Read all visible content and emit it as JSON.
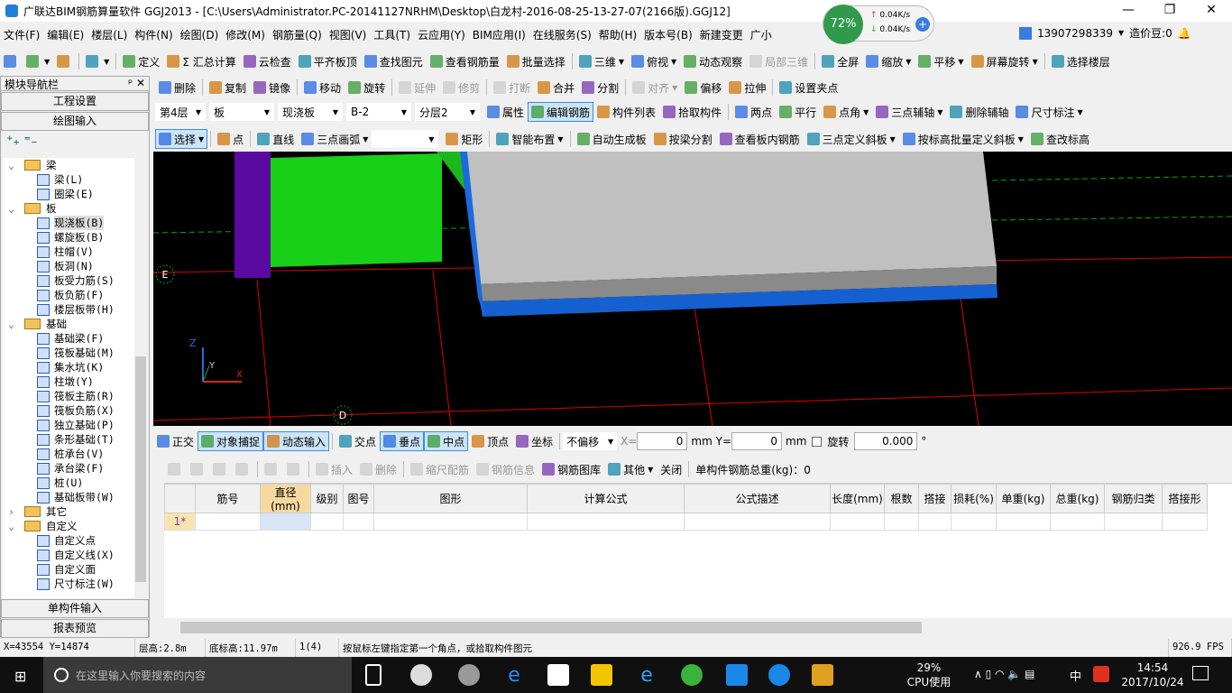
{
  "title": "广联达BIM钢筋算量软件 GGJ2013 - [C:\\Users\\Administrator.PC-20141127NRHM\\Desktop\\白龙村-2016-08-25-13-27-07(2166版).GGJ12]",
  "net_widget": {
    "percent": "72%",
    "up": "0.04K/s",
    "down": "0.04K/s"
  },
  "menu": [
    "文件(F)",
    "编辑(E)",
    "楼层(L)",
    "构件(N)",
    "绘图(D)",
    "修改(M)",
    "钢筋量(Q)",
    "视图(V)",
    "工具(T)",
    "云应用(Y)",
    "BIM应用(I)",
    "在线服务(S)",
    "帮助(H)",
    "版本号(B)",
    "新建变更",
    "广小"
  ],
  "account": {
    "phone": "13907298339",
    "beans": "造价豆:0"
  },
  "toolbar1": [
    {
      "icon": "new-file"
    },
    {
      "icon": "open-folder",
      "dd": true
    },
    {
      "icon": "save"
    },
    {
      "sep": true
    },
    {
      "icon": "undo",
      "dd": true
    },
    {
      "sep": true
    },
    {
      "label": "定义",
      "icon": "define"
    },
    {
      "label": "Σ 汇总计算",
      "icon": "sum"
    },
    {
      "label": "云检查",
      "icon": "cloud-check"
    },
    {
      "label": "平齐板顶",
      "icon": "align-slab"
    },
    {
      "label": "查找图元",
      "icon": "find"
    },
    {
      "label": "查看钢筋量",
      "icon": "view-rebar"
    },
    {
      "label": "批量选择",
      "icon": "batch-select"
    },
    {
      "sep": true
    },
    {
      "label": "三维",
      "icon": "3d",
      "dd": true
    },
    {
      "label": "俯视",
      "icon": "top-view",
      "dd": true
    },
    {
      "label": "动态观察",
      "icon": "orbit"
    },
    {
      "label": "局部三维",
      "icon": "local-3d",
      "disabled": true
    },
    {
      "sep": true
    },
    {
      "label": "全屏",
      "icon": "fullscreen"
    },
    {
      "label": "缩放",
      "icon": "zoom",
      "dd": true
    },
    {
      "label": "平移",
      "icon": "pan",
      "dd": true
    },
    {
      "label": "屏幕旋转",
      "icon": "rotate-screen",
      "dd": true
    },
    {
      "sep": true
    },
    {
      "label": "选择楼层",
      "icon": "select-floor"
    }
  ],
  "toolbar2": [
    {
      "label": "删除",
      "icon": "delete"
    },
    {
      "sep": true
    },
    {
      "label": "复制",
      "icon": "copy"
    },
    {
      "label": "镜像",
      "icon": "mirror"
    },
    {
      "sep": true
    },
    {
      "label": "移动",
      "icon": "move"
    },
    {
      "label": "旋转",
      "icon": "rotate"
    },
    {
      "sep": true
    },
    {
      "label": "延伸",
      "icon": "extend",
      "disabled": true
    },
    {
      "label": "修剪",
      "icon": "trim",
      "disabled": true
    },
    {
      "sep": true
    },
    {
      "label": "打断",
      "icon": "break",
      "disabled": true
    },
    {
      "label": "合并",
      "icon": "merge"
    },
    {
      "label": "分割",
      "icon": "split"
    },
    {
      "sep": true
    },
    {
      "label": "对齐",
      "icon": "align",
      "dd": true,
      "disabled": true
    },
    {
      "label": "偏移",
      "icon": "offset"
    },
    {
      "label": "拉伸",
      "icon": "stretch"
    },
    {
      "sep": true
    },
    {
      "label": "设置夹点",
      "icon": "grip"
    }
  ],
  "selectors": [
    "第4层",
    "板",
    "现浇板",
    "B-2",
    "分层2"
  ],
  "toolbar3": [
    {
      "label": "属性",
      "icon": "properties"
    },
    {
      "label": "编辑钢筋",
      "icon": "edit-rebar",
      "active": true
    },
    {
      "label": "构件列表",
      "icon": "component-list"
    },
    {
      "label": "拾取构件",
      "icon": "pick"
    },
    {
      "sep": true
    },
    {
      "label": "两点",
      "icon": "two-point"
    },
    {
      "label": "平行",
      "icon": "parallel"
    },
    {
      "label": "点角",
      "icon": "point-angle",
      "dd": true
    },
    {
      "label": "三点辅轴",
      "icon": "three-point-axis",
      "dd": true
    },
    {
      "label": "删除辅轴",
      "icon": "delete-axis"
    },
    {
      "label": "尺寸标注",
      "icon": "dimension",
      "dd": true
    }
  ],
  "toolbar4": [
    {
      "label": "选择",
      "icon": "select",
      "active": true,
      "dd": true
    },
    {
      "sep": true
    },
    {
      "label": "点",
      "icon": "point"
    },
    {
      "sep": true
    },
    {
      "label": "直线",
      "icon": "line"
    },
    {
      "label": "三点画弧",
      "icon": "arc",
      "dd": true
    },
    {
      "combo": ""
    },
    {
      "label": "矩形",
      "icon": "rectangle"
    },
    {
      "sep": true
    },
    {
      "label": "智能布置",
      "icon": "smart-layout",
      "dd": true
    },
    {
      "sep": true
    },
    {
      "label": "自动生成板",
      "icon": "auto-slab"
    },
    {
      "label": "按梁分割",
      "icon": "split-by-beam"
    },
    {
      "label": "查看板内钢筋",
      "icon": "view-slab-rebar"
    },
    {
      "label": "三点定义斜板",
      "icon": "sloped-slab",
      "dd": true
    },
    {
      "label": "按标高批量定义斜板",
      "icon": "batch-sloped",
      "dd": true
    },
    {
      "label": "查改标高",
      "icon": "elevation"
    }
  ],
  "panel": {
    "title": "模块导航栏",
    "project_settings": "工程设置",
    "drawing_input": "绘图输入",
    "single_input": "单构件输入",
    "report_preview": "报表预览"
  },
  "tree": [
    {
      "label": "梁",
      "folder": true,
      "lvl": 0
    },
    {
      "label": "梁(L)",
      "lvl": 1
    },
    {
      "label": "圈梁(E)",
      "lvl": 1
    },
    {
      "label": "板",
      "folder": true,
      "lvl": 0
    },
    {
      "label": "现浇板(B)",
      "lvl": 1,
      "selected": true
    },
    {
      "label": "螺旋板(B)",
      "lvl": 1
    },
    {
      "label": "柱帽(V)",
      "lvl": 1
    },
    {
      "label": "板洞(N)",
      "lvl": 1
    },
    {
      "label": "板受力筋(S)",
      "lvl": 1
    },
    {
      "label": "板负筋(F)",
      "lvl": 1
    },
    {
      "label": "楼层板带(H)",
      "lvl": 1
    },
    {
      "label": "基础",
      "folder": true,
      "lvl": 0
    },
    {
      "label": "基础梁(F)",
      "lvl": 1
    },
    {
      "label": "筏板基础(M)",
      "lvl": 1
    },
    {
      "label": "集水坑(K)",
      "lvl": 1
    },
    {
      "label": "柱墩(Y)",
      "lvl": 1
    },
    {
      "label": "筏板主筋(R)",
      "lvl": 1
    },
    {
      "label": "筏板负筋(X)",
      "lvl": 1
    },
    {
      "label": "独立基础(P)",
      "lvl": 1
    },
    {
      "label": "条形基础(T)",
      "lvl": 1
    },
    {
      "label": "桩承台(V)",
      "lvl": 1
    },
    {
      "label": "承台梁(F)",
      "lvl": 1
    },
    {
      "label": "桩(U)",
      "lvl": 1
    },
    {
      "label": "基础板带(W)",
      "lvl": 1
    },
    {
      "label": "其它",
      "folder": true,
      "lvl": 0,
      "collapsed": true
    },
    {
      "label": "自定义",
      "folder": true,
      "lvl": 0
    },
    {
      "label": "自定义点",
      "lvl": 1
    },
    {
      "label": "自定义线(X)",
      "lvl": 1
    },
    {
      "label": "自定义面",
      "lvl": 1
    },
    {
      "label": "尺寸标注(W)",
      "lvl": 1
    }
  ],
  "viewport": {
    "axis_labels": [
      "E",
      "D"
    ],
    "axes": {
      "z": "Z",
      "y": "Y",
      "x": "X"
    }
  },
  "snapbar": {
    "items": [
      {
        "label": "正交",
        "icon": "ortho"
      },
      {
        "label": "对象捕捉",
        "icon": "object-snap",
        "active": true
      },
      {
        "label": "动态输入",
        "icon": "dynamic-input",
        "active": true
      },
      {
        "sep": true
      },
      {
        "label": "交点",
        "icon": "intersection"
      },
      {
        "label": "垂点",
        "icon": "perpendicular",
        "active": true
      },
      {
        "label": "中点",
        "icon": "midpoint",
        "active": true
      },
      {
        "label": "顶点",
        "icon": "vertex"
      },
      {
        "label": "坐标",
        "icon": "coordinate"
      },
      {
        "sep": true
      }
    ],
    "offset": "不偏移",
    "x_label": "X=",
    "x_value": "0",
    "y_label": "Y=",
    "y_value": "0",
    "unit": "mm",
    "rotate_label": "旋转",
    "rotate_value": "0.000",
    "degree": "°"
  },
  "grid_toolbar": [
    {
      "icon": "first",
      "disabled": true
    },
    {
      "icon": "prev",
      "disabled": true
    },
    {
      "icon": "next",
      "disabled": true
    },
    {
      "icon": "last",
      "disabled": true
    },
    {
      "sep": true
    },
    {
      "icon": "up",
      "disabled": true
    },
    {
      "icon": "down",
      "disabled": true
    },
    {
      "sep": true
    },
    {
      "label": "插入",
      "icon": "insert",
      "disabled": true
    },
    {
      "label": "删除",
      "icon": "delete",
      "disabled": true
    },
    {
      "sep": true
    },
    {
      "label": "缩尺配筋",
      "icon": "scale-rebar",
      "disabled": true
    },
    {
      "label": "钢筋信息",
      "icon": "rebar-info",
      "disabled": true
    },
    {
      "label": "钢筋图库",
      "icon": "rebar-library"
    },
    {
      "label": "其他",
      "icon": "other",
      "dd": true
    },
    {
      "label": "关闭"
    },
    {
      "sep": true
    },
    {
      "label": "单构件钢筋总重(kg)：0"
    }
  ],
  "table": {
    "headers": [
      "",
      "筋号",
      "直径(mm)",
      "级别",
      "图号",
      "图形",
      "计算公式",
      "公式描述",
      "长度(mm)",
      "根数",
      "搭接",
      "损耗(%)",
      "单重(kg)",
      "总重(kg)",
      "钢筋归类",
      "搭接形"
    ],
    "rows": [
      [
        "1*",
        "",
        "",
        "",
        "",
        "",
        "",
        "",
        "",
        "",
        "",
        "",
        "",
        "",
        "",
        ""
      ]
    ]
  },
  "status": [
    "X=43554 Y=14874",
    "层高:2.8m",
    "底标高:11.97m",
    "1(4)",
    "按鼠标左键指定第一个角点，或拾取构件图元",
    "926.9 FPS"
  ],
  "taskbar": {
    "search_placeholder": "在这里输入你要搜索的内容",
    "cpu": "29%",
    "cpu_label": "CPU使用",
    "ime": "中",
    "time": "14:54",
    "date": "2017/10/24"
  }
}
